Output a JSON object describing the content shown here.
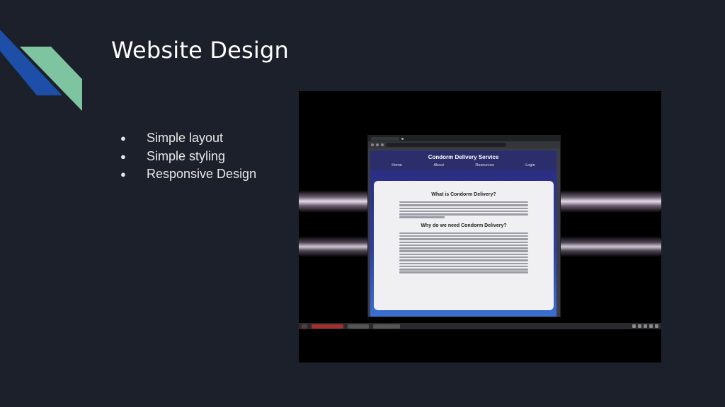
{
  "slide": {
    "title": "Website Design",
    "bullet_marker": "●",
    "bullets": [
      "Simple layout",
      "Simple styling",
      "Responsive Design"
    ]
  },
  "colors": {
    "background": "#1c202b",
    "accent_blue": "#1d4fa8",
    "accent_green": "#7fc4a0",
    "text": "#ffffff"
  },
  "embedded_video": {
    "site": {
      "title": "Condorm Delivery Service",
      "nav": [
        "Home",
        "About",
        "Resources",
        "Login"
      ],
      "heading_1": "What is Condorm Delivery?",
      "heading_2": "Why do we need Condorm Delivery?"
    }
  }
}
